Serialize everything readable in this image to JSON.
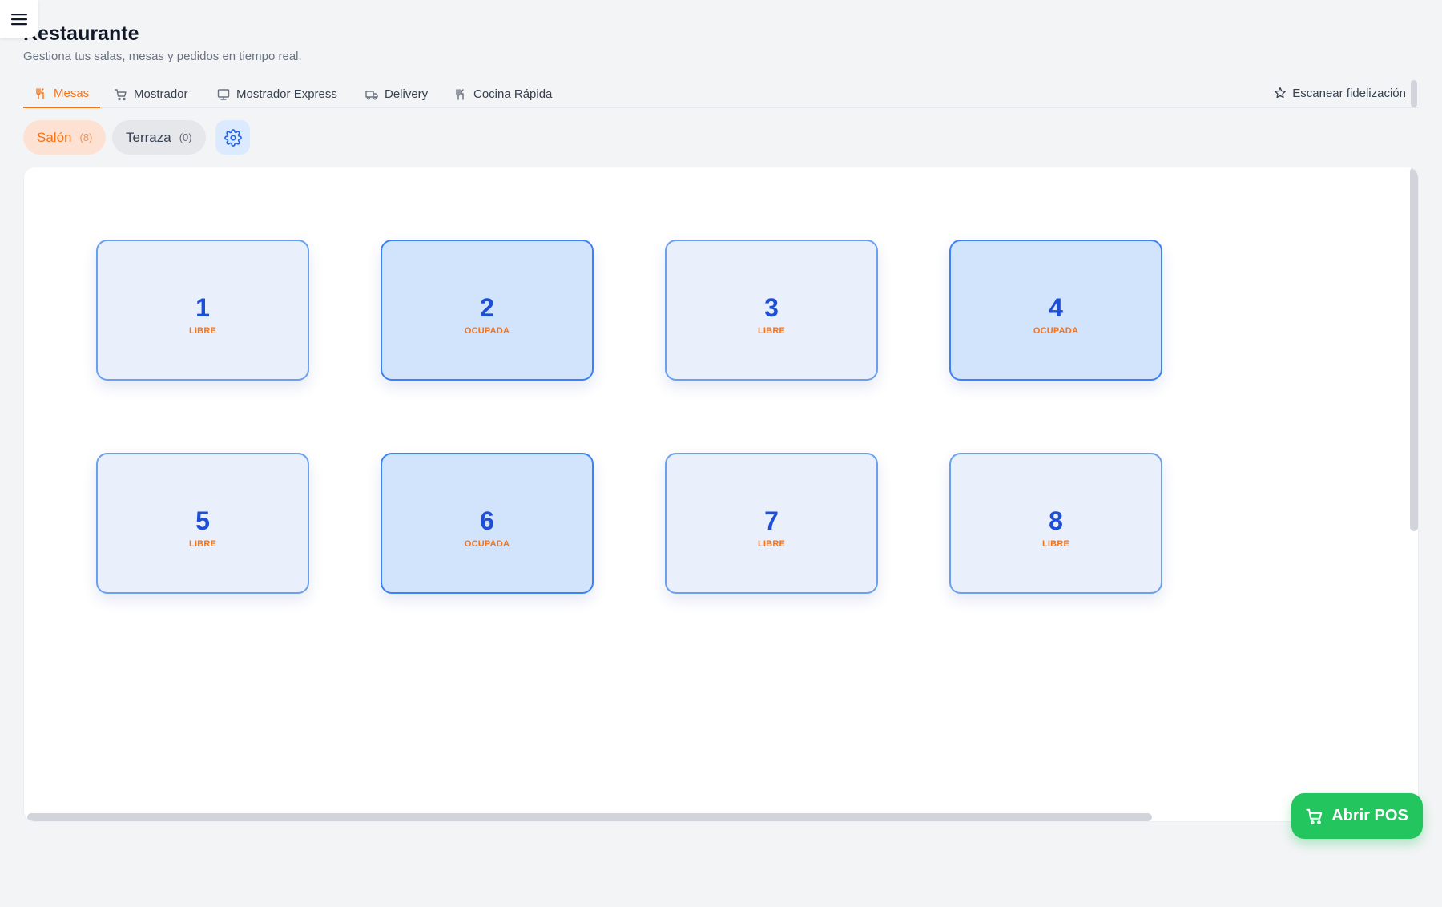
{
  "header": {
    "title": "Restaurante",
    "subtitle": "Gestiona tus salas, mesas y pedidos en tiempo real."
  },
  "tabs": [
    {
      "label": "Mesas",
      "icon": "utensils-icon",
      "active": true
    },
    {
      "label": "Mostrador",
      "icon": "cart-icon",
      "active": false
    },
    {
      "label": "Mostrador Express",
      "icon": "monitor-icon",
      "active": false
    },
    {
      "label": "Delivery",
      "icon": "truck-icon",
      "active": false
    },
    {
      "label": "Cocina Rápida",
      "icon": "utensils-icon",
      "active": false
    }
  ],
  "scan_button": {
    "label": "Escanear fidelización",
    "icon": "star-icon"
  },
  "rooms": [
    {
      "label": "Salón",
      "count": "(8)",
      "active": true
    },
    {
      "label": "Terraza",
      "count": "(0)",
      "active": false
    }
  ],
  "tables": [
    {
      "number": "1",
      "status": "LIBRE"
    },
    {
      "number": "2",
      "status": "OCUPADA"
    },
    {
      "number": "3",
      "status": "LIBRE"
    },
    {
      "number": "4",
      "status": "OCUPADA"
    },
    {
      "number": "5",
      "status": "LIBRE"
    },
    {
      "number": "6",
      "status": "OCUPADA"
    },
    {
      "number": "7",
      "status": "LIBRE"
    },
    {
      "number": "8",
      "status": "LIBRE"
    }
  ],
  "pos_button": {
    "label": "Abrir POS",
    "icon": "cart-icon"
  },
  "colors": {
    "accent": "#f97316",
    "primary": "#1d4ed8",
    "success": "#22c55e"
  }
}
